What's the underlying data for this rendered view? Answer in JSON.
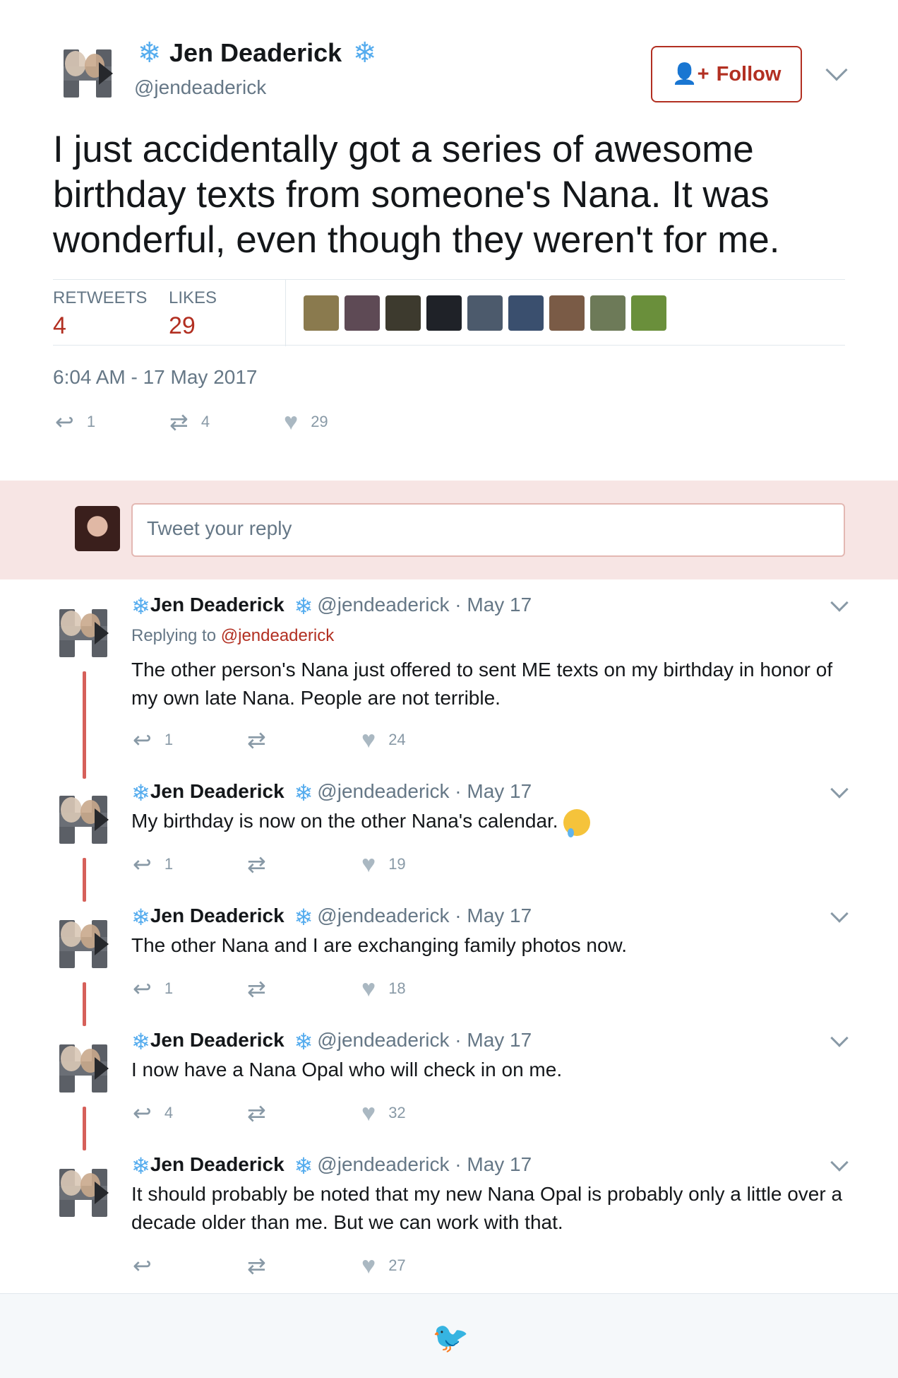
{
  "tweet": {
    "name": "Jen Deaderick",
    "handle": "@jendeaderick",
    "follow_label": "Follow",
    "text": "I just accidentally got a series of awesome birthday texts from someone's Nana. It was wonderful, even though they weren't for me.",
    "retweets_label": "RETWEETS",
    "retweets": "4",
    "likes_label": "LIKES",
    "likes": "29",
    "timestamp": "6:04 AM - 17 May 2017",
    "actions": {
      "replies": "1",
      "retweets": "4",
      "likes": "29"
    }
  },
  "likers": [
    "#8a7a4e",
    "#5e4a55",
    "#3d3a2e",
    "#1f2228",
    "#4c5a6c",
    "#3a4f6e",
    "#7a5b46",
    "#6d7a58",
    "#6a8f3b"
  ],
  "reply_box": {
    "placeholder": "Tweet your reply"
  },
  "replies": [
    {
      "name": "Jen Deaderick",
      "meta": "@jendeaderick · May 17",
      "replying_prefix": "Replying to",
      "replying_to": "@jendeaderick",
      "text": "The other person's Nana just offered to sent ME texts on my birthday in honor of my own late Nana. People are not terrible.",
      "replies": "1",
      "retweets": "",
      "likes": "24"
    },
    {
      "name": "Jen Deaderick",
      "meta": "@jendeaderick · May 17",
      "text": "My birthday is now on the other Nana's calendar.",
      "emoji": "crying-face",
      "replies": "1",
      "retweets": "",
      "likes": "19"
    },
    {
      "name": "Jen Deaderick",
      "meta": "@jendeaderick · May 17",
      "text": "The other Nana and I are exchanging family photos now.",
      "replies": "1",
      "retweets": "",
      "likes": "18"
    },
    {
      "name": "Jen Deaderick",
      "meta": "@jendeaderick · May 17",
      "text": "I now have a Nana Opal who will check in on me.",
      "replies": "4",
      "retweets": "",
      "likes": "32"
    },
    {
      "name": "Jen Deaderick",
      "meta": "@jendeaderick · May 17",
      "text": "It should probably be noted that my new Nana Opal is probably only a little over a decade older than me. But we can work with that.",
      "replies": "",
      "retweets": "",
      "likes": "27"
    }
  ],
  "colors": {
    "accent": "#b22f21",
    "thread": "#d6605a",
    "reply_bg": "#f7e5e4",
    "snowflake": "#55acee"
  }
}
